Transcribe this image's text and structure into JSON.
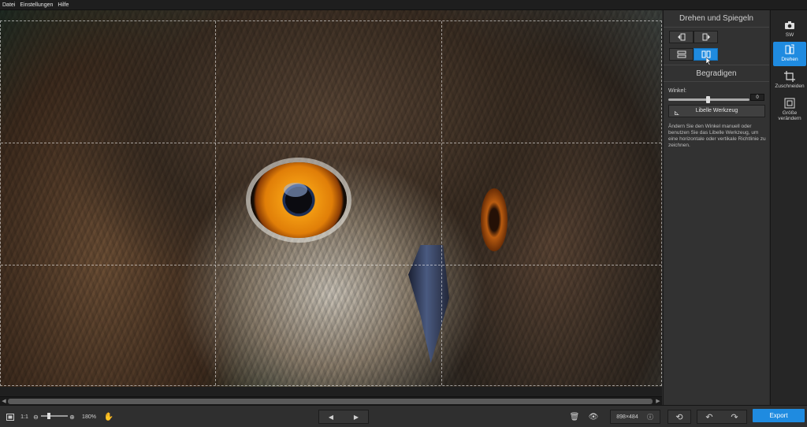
{
  "menu": {
    "file": "Datei",
    "settings": "Einstellungen",
    "help": "Hilfe"
  },
  "panel": {
    "rotate_title": "Drehen und Spiegeln",
    "straighten_title": "Begradigen",
    "angle_label": "Winkel:",
    "angle_value": "0",
    "angle_fraction": 0.5,
    "level_tool_label": "Libelle Werkzeug",
    "description": "Ändern Sie den Winkel manuell oder benutzen Sie das Libelle Werkzeug, um eine horizontale oder vertikale Richtlinie zu zeichnen."
  },
  "tools": {
    "sw": "SW",
    "rotate": "Drehen",
    "crop": "Zuschneiden",
    "resize": "Größe verändern"
  },
  "bottom": {
    "zoom_1to1": "1:1",
    "zoom_percent": "180%",
    "zoom_fraction": 0.3,
    "dimensions": "898×484",
    "export": "Export"
  },
  "colors": {
    "accent": "#1f8be0"
  }
}
